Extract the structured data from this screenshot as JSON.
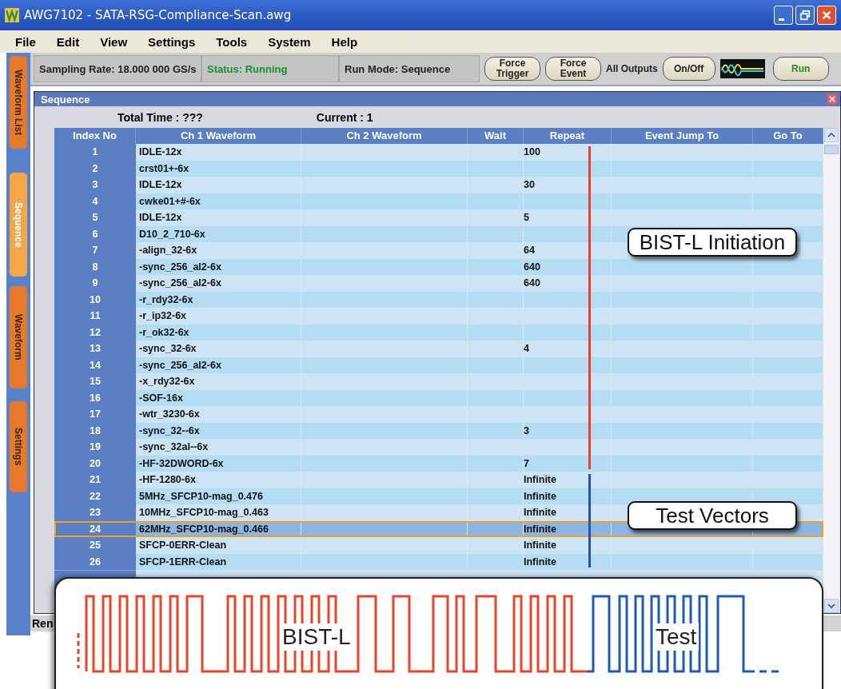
{
  "window": {
    "title": "AWG7102 - SATA-RSG-Compliance-Scan.awg"
  },
  "menu": [
    "File",
    "Edit",
    "View",
    "Settings",
    "Tools",
    "System",
    "Help"
  ],
  "side_tabs": [
    {
      "label": "Waveform List",
      "selected": false
    },
    {
      "label": "Sequence",
      "selected": true
    },
    {
      "label": "Waveform",
      "selected": false
    },
    {
      "label": "Settings",
      "selected": false
    }
  ],
  "toolbar": {
    "sampling_rate": "Sampling Rate: 18.000 000  GS/s",
    "status": "Status: Running",
    "run_mode": "Run Mode: Sequence",
    "items": [
      {
        "kind": "button",
        "label": "Force Trigger"
      },
      {
        "kind": "button",
        "label": "Force Event"
      },
      {
        "kind": "text",
        "label": "All Outputs"
      },
      {
        "kind": "button",
        "label": "On/Off"
      },
      {
        "kind": "scope"
      },
      {
        "kind": "run",
        "label": "Run"
      }
    ]
  },
  "sequence": {
    "title": "Sequence",
    "total_time": "Total Time : ???",
    "current": "Current :  1",
    "columns": [
      "Index No",
      "Ch 1 Waveform",
      "Ch 2 Waveform",
      "Wait",
      "Repeat",
      "Event Jump To",
      "Go To"
    ],
    "row_groups": [
      {
        "callout": "BIST-L Initiation",
        "color": "#e8402a",
        "rows": [
          {
            "index": "1",
            "ch1": "IDLE-12x",
            "repeat": "100",
            "selected": false
          },
          {
            "index": "2",
            "ch1": "crst01+-6x",
            "selected": false
          },
          {
            "index": "3",
            "ch1": "IDLE-12x",
            "repeat": "30",
            "selected": false
          },
          {
            "index": "4",
            "ch1": "cwke01+#-6x",
            "selected": false
          },
          {
            "index": "5",
            "ch1": "IDLE-12x",
            "repeat": "5",
            "selected": false
          },
          {
            "index": "6",
            "ch1": "D10_2_710-6x",
            "selected": false
          },
          {
            "index": "7",
            "ch1": "-align_32-6x",
            "repeat": "64",
            "selected": false
          },
          {
            "index": "8",
            "ch1": "-sync_256_al2-6x",
            "repeat": "640",
            "selected": false
          },
          {
            "index": "9",
            "ch1": "-sync_256_al2-6x",
            "repeat": "640",
            "selected": false
          },
          {
            "index": "10",
            "ch1": "-r_rdy32-6x",
            "selected": false
          },
          {
            "index": "11",
            "ch1": "-r_ip32-6x",
            "selected": false
          },
          {
            "index": "12",
            "ch1": "-r_ok32-6x",
            "selected": false
          },
          {
            "index": "13",
            "ch1": "-sync_32-6x",
            "repeat": "4",
            "selected": false
          },
          {
            "index": "14",
            "ch1": "-sync_256_al2-6x",
            "selected": false
          },
          {
            "index": "15",
            "ch1": "-x_rdy32-6x",
            "selected": false
          },
          {
            "index": "16",
            "ch1": "-SOF-16x",
            "selected": false
          },
          {
            "index": "17",
            "ch1": "-wtr_3230-6x",
            "selected": false
          },
          {
            "index": "18",
            "ch1": "-sync_32--6x",
            "repeat": "3",
            "selected": false
          },
          {
            "index": "19",
            "ch1": "-sync_32al--6x",
            "selected": false
          },
          {
            "index": "20",
            "ch1": "-HF-32DWORD-6x",
            "repeat": "7",
            "selected": false
          }
        ]
      },
      {
        "callout": "Test Vectors",
        "color": "#1f55b0",
        "rows": [
          {
            "index": "21",
            "ch1": "-HF-1280-6x",
            "repeat": "Infinite",
            "selected": false
          },
          {
            "index": "22",
            "ch1": "5MHz_SFCP10-mag_0.476",
            "repeat": "Infinite",
            "selected": false
          },
          {
            "index": "23",
            "ch1": "10MHz_SFCP10-mag_0.463",
            "repeat": "Infinite",
            "selected": false
          },
          {
            "index": "24",
            "ch1": "62MHz_SFCP10-mag_0.466",
            "repeat": "Infinite",
            "selected": true
          },
          {
            "index": "25",
            "ch1": "SFCP-0ERR-Clean",
            "repeat": "Infinite",
            "selected": false
          },
          {
            "index": "26",
            "ch1": "SFCP-1ERR-Clean",
            "repeat": "Infinite",
            "selected": false
          }
        ]
      }
    ]
  },
  "status_bar": {
    "text": "Ren"
  },
  "waveform_card": {
    "segments": [
      {
        "label": "BIST-L",
        "color": "#e8452a"
      },
      {
        "label": "Test",
        "color": "#1f5ab5"
      }
    ]
  }
}
